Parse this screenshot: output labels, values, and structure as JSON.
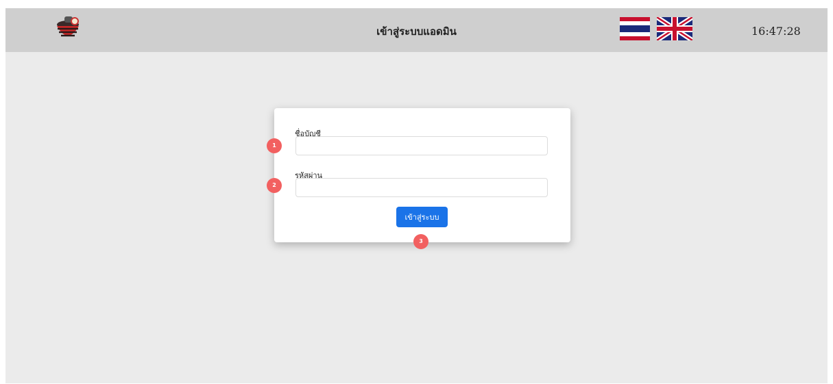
{
  "header": {
    "title": "เข้าสู่ระบบแอดมิน",
    "clock": "16:47:28",
    "languages": [
      {
        "name": "thai-flag-icon"
      },
      {
        "name": "uk-flag-icon"
      }
    ]
  },
  "login": {
    "username_label": "ชื่อบัญชี",
    "username_value": "",
    "password_label": "รหัสผ่าน",
    "password_value": "",
    "submit_label": "เข้าสู่ระบบ"
  },
  "markers": [
    "1",
    "2",
    "3"
  ],
  "colors": {
    "header_bg": "#cfcfcf",
    "page_bg": "#ebebeb",
    "button": "#1a73e8",
    "marker": "#f26060"
  }
}
